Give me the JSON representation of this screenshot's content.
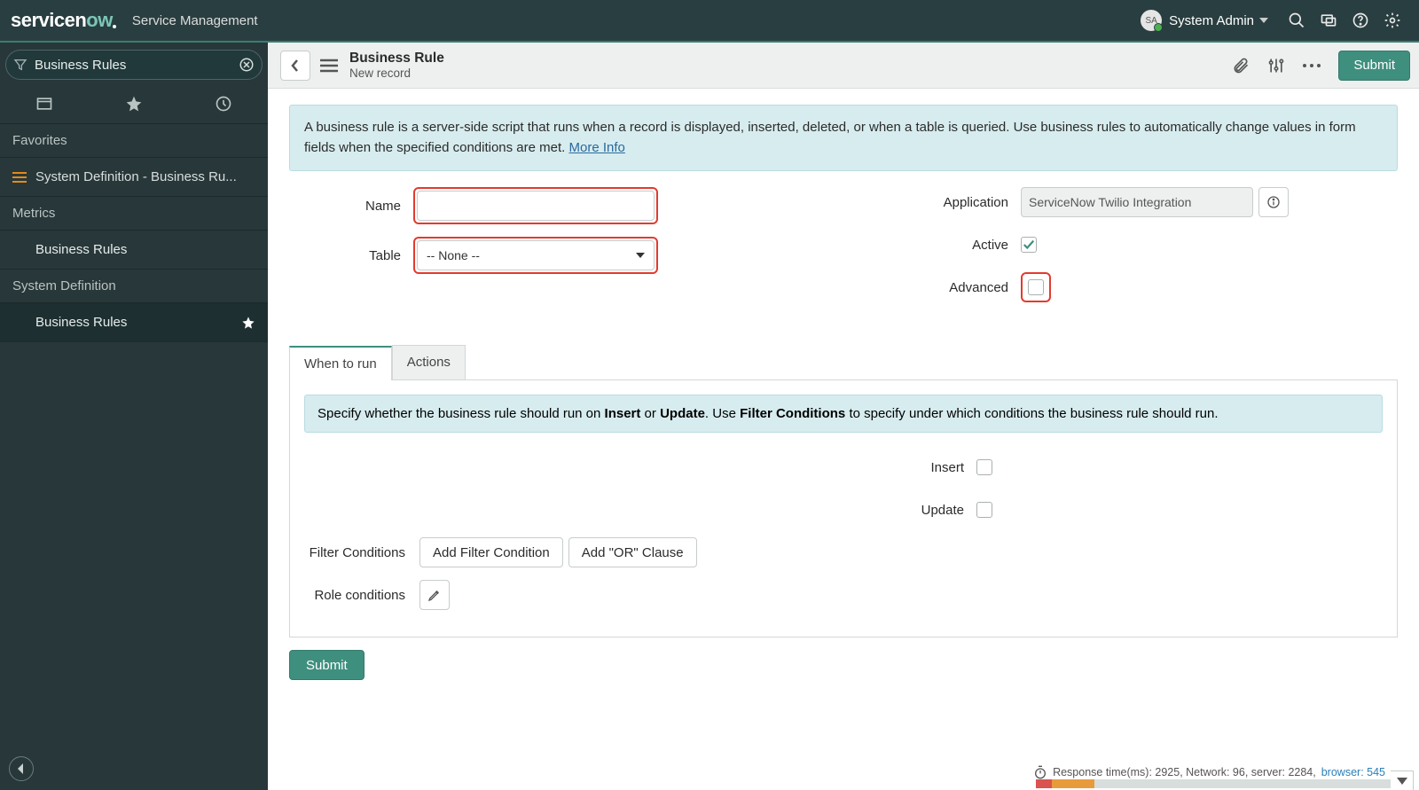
{
  "banner": {
    "product": "servicen",
    "product_suffix": "ow",
    "sub": "Service Management",
    "user_initials": "SA",
    "user_name": "System Admin"
  },
  "nav": {
    "filter_value": "Business Rules",
    "sections": {
      "favorites": "Favorites",
      "fav_item": "System Definition - Business Ru...",
      "metrics": "Metrics",
      "metrics_item": "Business Rules",
      "sysdef": "System Definition",
      "sysdef_item": "Business Rules"
    }
  },
  "header": {
    "title": "Business Rule",
    "subtitle": "New record",
    "submit": "Submit"
  },
  "info": {
    "text": "A business rule is a server-side script that runs when a record is displayed, inserted, deleted, or when a table is queried. Use business rules to automatically change values in form fields when the specified conditions are met. ",
    "more": "More Info"
  },
  "fields": {
    "name_label": "Name",
    "name_value": "",
    "table_label": "Table",
    "table_value": "-- None --",
    "application_label": "Application",
    "application_value": "ServiceNow Twilio Integration",
    "active_label": "Active",
    "advanced_label": "Advanced"
  },
  "tabs": {
    "when": "When to run",
    "actions": "Actions"
  },
  "when": {
    "hint_pre": "Specify whether the business rule should run on ",
    "hint_b1": "Insert",
    "hint_mid1": " or ",
    "hint_b2": "Update",
    "hint_mid2": ". Use ",
    "hint_b3": "Filter Conditions",
    "hint_post": " to specify under which conditions the business rule should run.",
    "insert_label": "Insert",
    "update_label": "Update",
    "filter_label": "Filter Conditions",
    "add_filter": "Add Filter Condition",
    "add_or": "Add \"OR\" Clause",
    "role_label": "Role conditions"
  },
  "footer": {
    "submit": "Submit",
    "timing_text": "Response time(ms): 2925, Network: 96, server: 2284, ",
    "timing_link": "browser: 545"
  }
}
